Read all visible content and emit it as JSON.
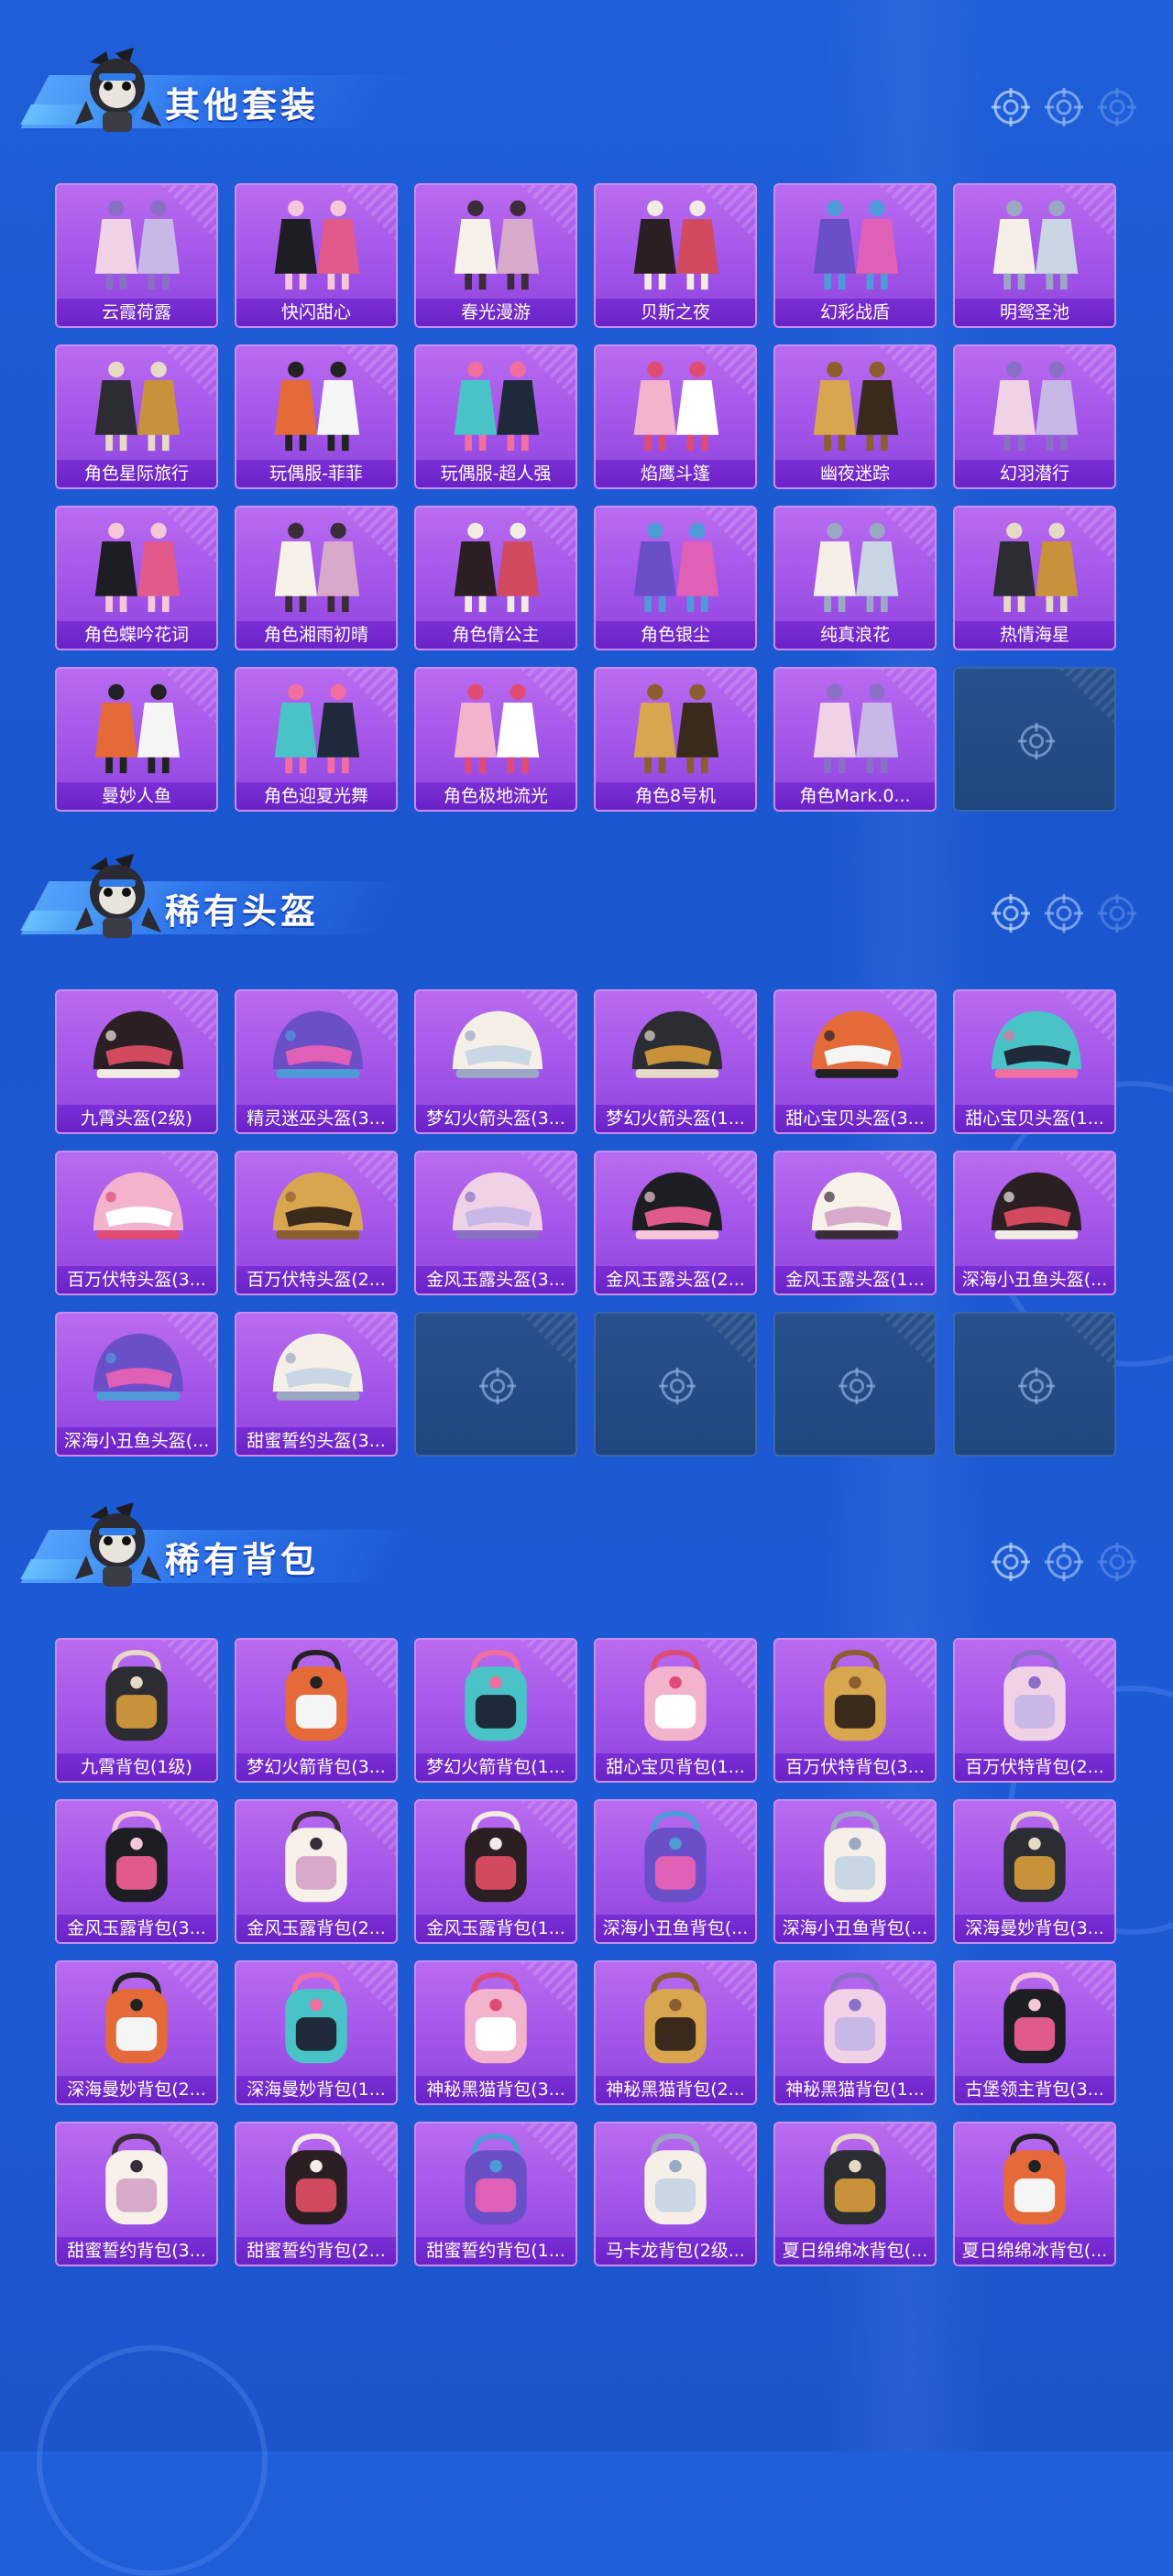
{
  "sections": [
    {
      "title": "其他套装",
      "items": [
        "云霞荷露",
        "快闪甜心",
        "春光漫游",
        "贝斯之夜",
        "幻彩战盾",
        "明鸳圣池",
        "角色星际旅行",
        "玩偶服-菲菲",
        "玩偶服-超人强",
        "焰鹰斗篷",
        "幽夜迷踪",
        "幻羽潜行",
        "角色蝶吟花词",
        "角色湘雨初晴",
        "角色倩公主",
        "角色银尘",
        "纯真浪花",
        "热情海星",
        "曼妙人鱼",
        "角色迎夏光舞",
        "角色极地流光",
        "角色8号机",
        "角色Mark.0..."
      ],
      "empty_slots": 1
    },
    {
      "title": "稀有头盔",
      "items": [
        "九霄头盔(2级)",
        "精灵迷巫头盔(3...",
        "梦幻火箭头盔(3...",
        "梦幻火箭头盔(1...",
        "甜心宝贝头盔(3...",
        "甜心宝贝头盔(1...",
        "百万伏特头盔(3...",
        "百万伏特头盔(2...",
        "金风玉露头盔(3...",
        "金风玉露头盔(2...",
        "金风玉露头盔(1...",
        "深海小丑鱼头盔(...",
        "深海小丑鱼头盔(...",
        "甜蜜誓约头盔(3..."
      ],
      "empty_slots": 4
    },
    {
      "title": "稀有背包",
      "items": [
        "九霄背包(1级)",
        "梦幻火箭背包(3...",
        "梦幻火箭背包(1...",
        "甜心宝贝背包(1...",
        "百万伏特背包(3...",
        "百万伏特背包(2...",
        "金风玉露背包(3...",
        "金风玉露背包(2...",
        "金风玉露背包(1...",
        "深海小丑鱼背包(...",
        "深海小丑鱼背包(...",
        "深海曼妙背包(3...",
        "深海曼妙背包(2...",
        "深海曼妙背包(1...",
        "神秘黑猫背包(3...",
        "神秘黑猫背包(2...",
        "神秘黑猫背包(1...",
        "古堡领主背包(3...",
        "甜蜜誓约背包(3...",
        "甜蜜誓约背包(2...",
        "甜蜜誓约背包(1...",
        "马卡龙背包(2级...",
        "夏日绵绵冰背包(...",
        "夏日绵绵冰背包(..."
      ],
      "empty_slots": 0
    }
  ],
  "colors": {
    "card": "#a255e8",
    "label": "#6a22c6",
    "empty": "#1f477f",
    "background": "#1f5fd9"
  }
}
